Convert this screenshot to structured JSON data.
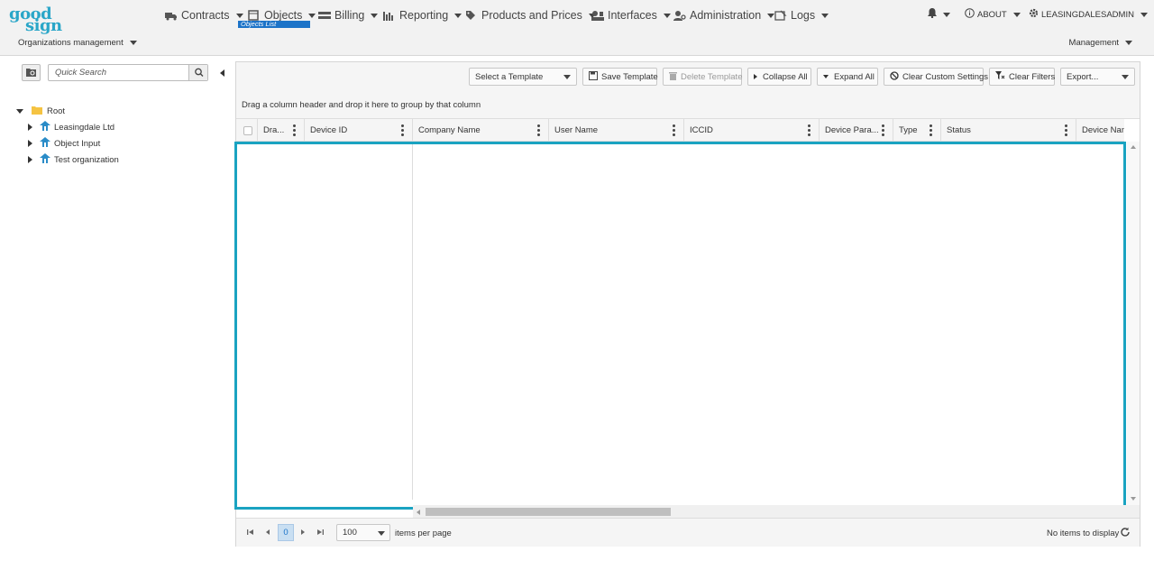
{
  "brand": {
    "line1": "good",
    "line2": "sign"
  },
  "nav": {
    "contracts": "Contracts",
    "objects": "Objects",
    "objects_sub": "Objects List",
    "billing": "Billing",
    "reporting": "Reporting",
    "products": "Products and Prices",
    "interfaces": "Interfaces",
    "administration": "Administration",
    "logs": "Logs",
    "about": "ABOUT",
    "user": "LEASINGDALESADMIN"
  },
  "subheader": {
    "org_mgmt": "Organizations management",
    "management": "Management"
  },
  "sidebar": {
    "quick_search_placeholder": "Quick Search",
    "tree": {
      "root": "Root",
      "children": [
        "Leasingdale Ltd",
        "Object Input",
        "Test organization"
      ]
    }
  },
  "toolbar": {
    "select_template": "Select a Template",
    "save_template": "Save Template",
    "delete_template": "Delete Template",
    "collapse_all": "Collapse All",
    "expand_all": "Expand All",
    "clear_custom": "Clear Custom Settings",
    "clear_filters": "Clear Filters",
    "export": "Export..."
  },
  "grid": {
    "group_hint": "Drag a column header and drop it here to group by that column",
    "columns": [
      "Dra...",
      "Device ID",
      "Company Name",
      "User Name",
      "ICCID",
      "Device Para...",
      "Type",
      "Status",
      "Device Nam"
    ]
  },
  "pager": {
    "current_page": "0",
    "page_size": "100",
    "items_per_page": "items per page",
    "no_items": "No items to display"
  },
  "colors": {
    "accent": "#1aa3c1",
    "brand": "#2aa6c8",
    "active_nav": "#1c73c8"
  }
}
